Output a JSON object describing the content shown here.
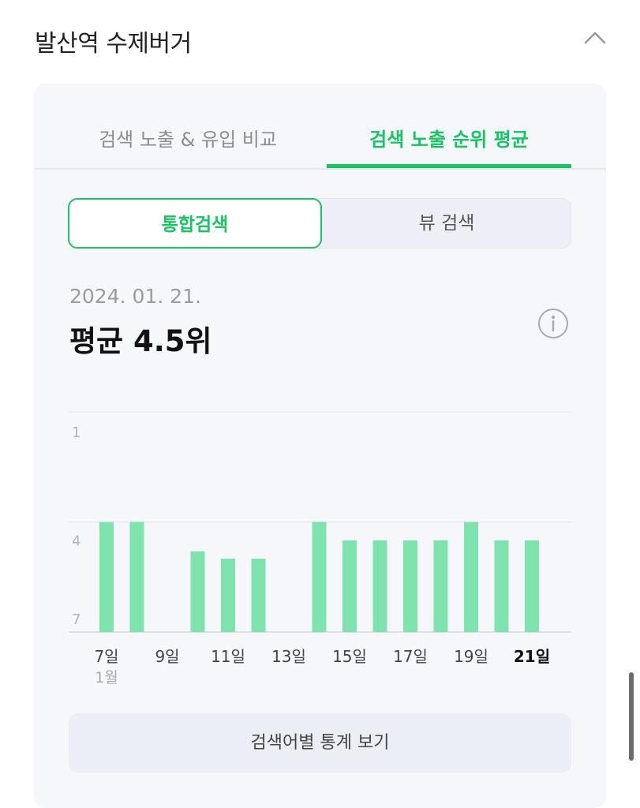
{
  "header": {
    "title": "발산역 수제버거",
    "collapse_icon": "chevron-up-icon"
  },
  "tabs": [
    {
      "label": "검색 노출 & 유입 비교",
      "active": false
    },
    {
      "label": "검색 노출 순위 평균",
      "active": true
    }
  ],
  "segment": {
    "options": [
      "통합검색",
      "뷰 검색"
    ],
    "selected": "통합검색"
  },
  "summary": {
    "date": "2024. 01. 21.",
    "average": "평균 4.5위",
    "info_icon": "info-icon"
  },
  "colors": {
    "accent": "#19c464",
    "bar": "#7fe3ad"
  },
  "chart_data": {
    "type": "bar",
    "x": [
      7,
      8,
      9,
      10,
      11,
      12,
      13,
      14,
      15,
      16,
      17,
      18,
      19,
      20,
      21
    ],
    "values": [
      4,
      4,
      null,
      4.8,
      5,
      5,
      null,
      4,
      4.5,
      4.5,
      4.5,
      4.5,
      4,
      4.5,
      4.5
    ],
    "y_ticks": [
      "1",
      "4",
      "7"
    ],
    "ylim": [
      1,
      7
    ],
    "y_inverted": true,
    "x_tick_labels": [
      "7일",
      "9일",
      "11일",
      "13일",
      "15일",
      "17일",
      "19일",
      "21일"
    ],
    "x_month_label": "1월",
    "highlighted_label": "21일",
    "grid": true
  },
  "footer": {
    "stats_button": "검색어별 통계 보기"
  }
}
